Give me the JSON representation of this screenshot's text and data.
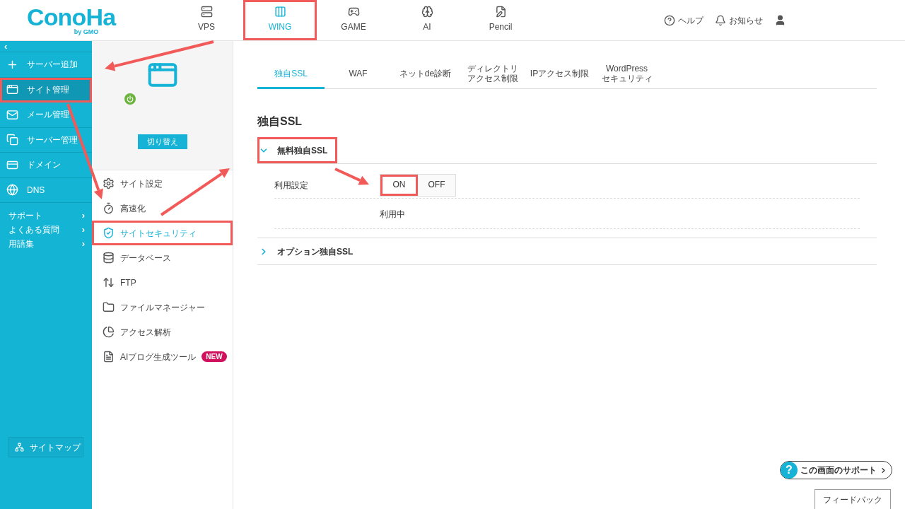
{
  "logo": {
    "text": "ConoHa",
    "sub": "by GMO"
  },
  "nav": [
    {
      "label": "VPS",
      "selected": false,
      "highlighted": false
    },
    {
      "label": "WING",
      "selected": true,
      "highlighted": true
    },
    {
      "label": "GAME",
      "selected": false,
      "highlighted": false
    },
    {
      "label": "AI",
      "selected": false,
      "highlighted": false
    },
    {
      "label": "Pencil",
      "selected": false,
      "highlighted": false
    }
  ],
  "header_links": [
    {
      "label": "ヘルプ"
    },
    {
      "label": "お知らせ"
    }
  ],
  "sidebar": {
    "collapse": "‹",
    "items": [
      {
        "label": "サーバー追加",
        "selected": false,
        "highlighted": false
      },
      {
        "label": "サイト管理",
        "selected": true,
        "highlighted": true
      },
      {
        "label": "メール管理",
        "selected": false,
        "highlighted": false
      },
      {
        "label": "サーバー管理",
        "selected": false,
        "highlighted": false
      },
      {
        "label": "ドメイン",
        "selected": false,
        "highlighted": false
      },
      {
        "label": "DNS",
        "selected": false,
        "highlighted": false
      }
    ],
    "links": [
      {
        "label": "サポート",
        "arrow": "›"
      },
      {
        "label": "よくある質問",
        "arrow": "›"
      },
      {
        "label": "用語集",
        "arrow": "›"
      }
    ],
    "sitemap": "サイトマップ"
  },
  "site_panel": {
    "power_on": true,
    "switch_button": "切り替え"
  },
  "site_menu": [
    {
      "label": "サイト設定",
      "selected": false,
      "highlighted": false
    },
    {
      "label": "高速化",
      "selected": false,
      "highlighted": false
    },
    {
      "label": "サイトセキュリティ",
      "selected": true,
      "highlighted": true
    },
    {
      "label": "データベース",
      "selected": false,
      "highlighted": false
    },
    {
      "label": "FTP",
      "selected": false,
      "highlighted": false
    },
    {
      "label": "ファイルマネージャー",
      "selected": false,
      "highlighted": false
    },
    {
      "label": "アクセス解析",
      "selected": false,
      "highlighted": false
    },
    {
      "label": "AIブログ生成ツール",
      "selected": false,
      "highlighted": false,
      "badge": "NEW"
    }
  ],
  "tabs": [
    {
      "lines": [
        "独自SSL"
      ],
      "selected": true
    },
    {
      "lines": [
        "WAF"
      ],
      "selected": false
    },
    {
      "lines": [
        "ネットde診断"
      ],
      "selected": false
    },
    {
      "lines": [
        "ディレクトリ",
        "アクセス制限"
      ],
      "selected": false
    },
    {
      "lines": [
        "IPアクセス制限"
      ],
      "selected": false
    },
    {
      "lines": [
        "WordPress",
        "セキュリティ"
      ],
      "selected": false
    }
  ],
  "section": {
    "title": "独自SSL",
    "accordions": [
      {
        "title": "無料独自SSL",
        "expanded": true,
        "highlighted": true,
        "setting_label": "利用設定",
        "options": [
          {
            "label": "ON",
            "selected": true,
            "highlighted": true
          },
          {
            "label": "OFF",
            "selected": false,
            "highlighted": false
          }
        ],
        "status": "利用中"
      },
      {
        "title": "オプション独自SSL",
        "expanded": false,
        "highlighted": false
      }
    ]
  },
  "support_button": {
    "icon_text": "?",
    "label": "この画面のサポート"
  },
  "feedback_button": "フィードバック"
}
